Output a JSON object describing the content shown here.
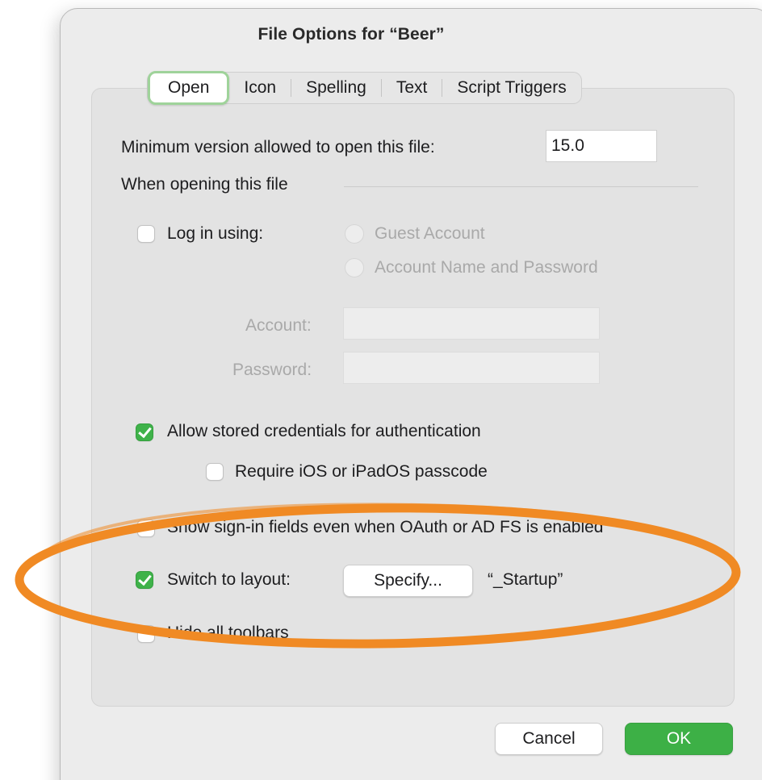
{
  "dialog": {
    "title": "File Options for “Beer”"
  },
  "tabs": [
    {
      "label": "Open",
      "active": true
    },
    {
      "label": "Icon",
      "active": false
    },
    {
      "label": "Spelling",
      "active": false
    },
    {
      "label": "Text",
      "active": false
    },
    {
      "label": "Script Triggers",
      "active": false
    }
  ],
  "open_tab": {
    "min_version_label": "Minimum version allowed to open this file:",
    "min_version_value": "15.0",
    "when_opening_label": "When opening this file",
    "log_in": {
      "label": "Log in using:",
      "checked": false,
      "options": [
        "Guest Account",
        "Account Name and Password"
      ]
    },
    "account_label": "Account:",
    "account_value": "",
    "password_label": "Password:",
    "password_value": "",
    "allow_stored_credentials": {
      "label": "Allow stored credentials for authentication",
      "checked": true
    },
    "require_passcode": {
      "label": "Require iOS or iPadOS passcode",
      "checked": false
    },
    "show_signin_fields": {
      "label": "Show sign-in fields even when OAuth or AD FS is enabled",
      "checked": false
    },
    "switch_layout": {
      "label": "Switch to layout:",
      "checked": true,
      "button_label": "Specify...",
      "layout_name": "“_Startup”"
    },
    "hide_toolbars": {
      "label": "Hide all toolbars",
      "checked": false
    }
  },
  "footer": {
    "cancel_label": "Cancel",
    "ok_label": "OK"
  },
  "colors": {
    "accent_green": "#3db046",
    "annotation_orange": "#f08a24"
  }
}
